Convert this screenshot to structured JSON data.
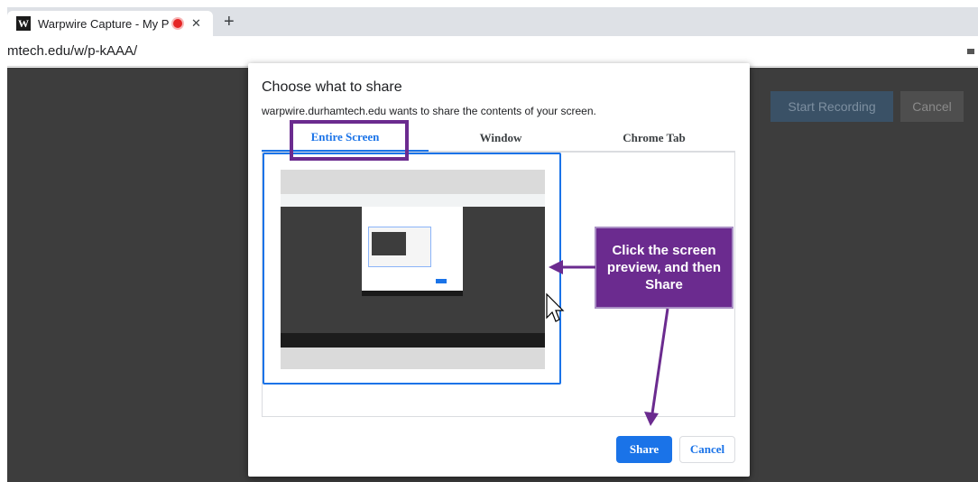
{
  "browser": {
    "tab_title": "Warpwire Capture - My Pract",
    "tab_favicon_letter": "W",
    "tab_close": "✕",
    "new_tab": "+",
    "url": "mtech.edu/w/p-kAAA/"
  },
  "page": {
    "start_recording_label": "Start Recording",
    "cancel_label": "Cancel"
  },
  "dialog": {
    "title": "Choose what to share",
    "subtitle": "warpwire.durhamtech.edu wants to share the contents of your screen.",
    "tabs": [
      {
        "label": "Entire Screen",
        "active": true
      },
      {
        "label": "Window",
        "active": false
      },
      {
        "label": "Chrome Tab",
        "active": false
      }
    ],
    "share_label": "Share",
    "cancel_label": "Cancel"
  },
  "annotation": {
    "callout_text": "Click the screen preview, and then Share",
    "color": "#6b2b8f"
  },
  "colors": {
    "accent": "#1a73e8",
    "page_bg": "#3d3d3d",
    "annotation": "#6b2b8f"
  },
  "icons": [
    "warpwire-favicon",
    "recording-dot-icon",
    "close-icon",
    "plus-icon",
    "cursor-icon",
    "arrow-left-icon",
    "arrow-down-icon"
  ]
}
